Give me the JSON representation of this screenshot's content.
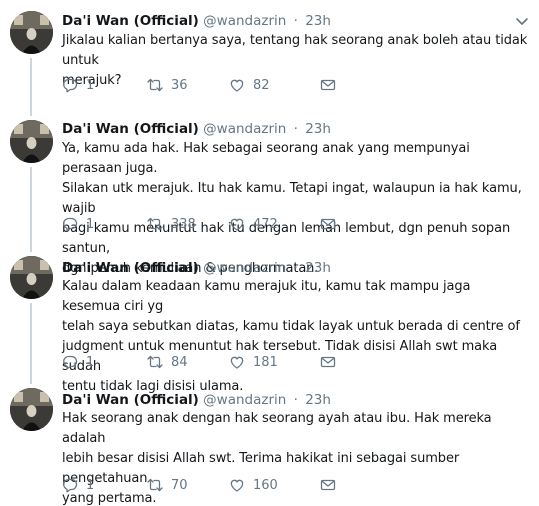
{
  "tweets": [
    {
      "name": "Da'i Wan (Official)",
      "handle": "@wandazrin",
      "separator": "·",
      "time": "23h",
      "text": "Jikalau kalian bertanya saya, tentang hak seorang anak boleh atau tidak untuk\nmerajuk?",
      "replies": "1",
      "retweets": "36",
      "likes": "82"
    },
    {
      "name": "Da'i Wan (Official)",
      "handle": "@wandazrin",
      "separator": "·",
      "time": "23h",
      "text": "Ya, kamu ada hak. Hak sebagai seorang anak yang mempunyai perasaan juga.\nSilakan utk merajuk. Itu hak kamu. Tetapi ingat, walaupun ia hak kamu, wajib\nbagi kamu menuntut hak itu dengan lemah lembut, dgn penuh sopan santun,\ndgn penuh kemuliaan & penghormatan.",
      "replies": "1",
      "retweets": "338",
      "likes": "472"
    },
    {
      "name": "Da'i Wan (Official)",
      "handle": "@wandazrin",
      "separator": "·",
      "time": "23h",
      "text": "Kalau dalam keadaan kamu merajuk itu, kamu tak mampu jaga kesemua ciri yg\ntelah saya sebutkan diatas, kamu tidak layak untuk berada di centre of\njudgment untuk menuntut hak tersebut. Tidak disisi Allah swt maka sudah\ntentu tidak lagi disisi ulama.",
      "replies": "1",
      "retweets": "84",
      "likes": "181"
    },
    {
      "name": "Da'i Wan (Official)",
      "handle": "@wandazrin",
      "separator": "·",
      "time": "23h",
      "text": "Hak seorang anak dengan hak seorang ayah atau ibu. Hak mereka adalah\nlebih besar disisi Allah swt. Terima hakikat ini sebagai sumber pengetahuan\nyang pertama.",
      "replies": "1",
      "retweets": "70",
      "likes": "160"
    }
  ],
  "icons": {
    "reply": "speech-bubble-icon",
    "retweet": "retweet-arrows-icon",
    "like": "heart-icon",
    "dm": "envelope-icon",
    "more": "chevron-down-icon"
  },
  "colors": {
    "name": "#14171a",
    "secondary": "#657786",
    "thread_line": "#ccd6dd",
    "background": "#ffffff"
  }
}
